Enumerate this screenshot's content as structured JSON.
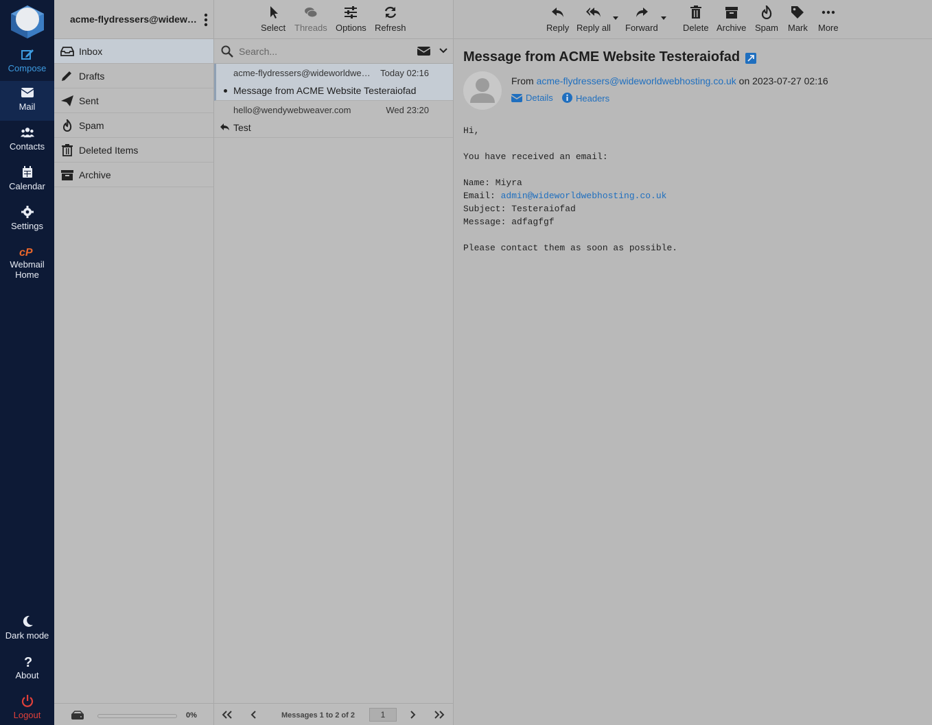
{
  "nav": {
    "items": [
      {
        "id": "compose",
        "label": "Compose"
      },
      {
        "id": "mail",
        "label": "Mail"
      },
      {
        "id": "contacts",
        "label": "Contacts"
      },
      {
        "id": "calendar",
        "label": "Calendar"
      },
      {
        "id": "settings",
        "label": "Settings"
      },
      {
        "id": "webmail-home",
        "label": "Webmail Home"
      },
      {
        "id": "dark-mode",
        "label": "Dark mode"
      },
      {
        "id": "about",
        "label": "About"
      },
      {
        "id": "logout",
        "label": "Logout"
      }
    ],
    "webmail_home_line1": "Webmail",
    "webmail_home_line2": "Home"
  },
  "folders": {
    "account": "acme-flydressers@wideworldwebhosting.co.uk",
    "items": [
      {
        "name": "Inbox",
        "icon": "inbox-icon",
        "selected": true
      },
      {
        "name": "Drafts",
        "icon": "pencil-icon"
      },
      {
        "name": "Sent",
        "icon": "paper-plane-icon"
      },
      {
        "name": "Spam",
        "icon": "fire-icon"
      },
      {
        "name": "Deleted Items",
        "icon": "trash-icon"
      },
      {
        "name": "Archive",
        "icon": "archive-icon"
      }
    ],
    "quota": {
      "percent_label": "0%",
      "fraction": 0
    }
  },
  "list_toolbar": {
    "select": "Select",
    "threads": "Threads",
    "options": "Options",
    "refresh": "Refresh"
  },
  "search": {
    "placeholder": "Search..."
  },
  "messages": [
    {
      "from": "acme-flydressers@wideworldwebhosting.co.uk",
      "date": "Today 02:16",
      "subject": "Message from ACME Website Testeraiofad",
      "selected": true,
      "unread": true
    },
    {
      "from": "hello@wendywebweaver.com",
      "date": "Wed 23:20",
      "subject": "Test",
      "replied": true
    }
  ],
  "list_footer": {
    "count": "Messages 1 to 2 of 2",
    "page": "1"
  },
  "reader_toolbar": {
    "reply": "Reply",
    "reply_all": "Reply all",
    "forward": "Forward",
    "delete": "Delete",
    "archive": "Archive",
    "spam": "Spam",
    "mark": "Mark",
    "more": "More"
  },
  "message": {
    "subject": "Message from ACME Website Testeraiofad",
    "from_prefix": "From",
    "from_address": "acme-flydressers@wideworldwebhosting.co.uk",
    "date_prefix": "on",
    "date": "2023-07-27 02:16",
    "details_label": "Details",
    "headers_label": "Headers",
    "body": {
      "greeting": "Hi,",
      "intro": "You have received an email:",
      "name_line": "Name: Miyra",
      "email_prefix": "Email: ",
      "email": "admin@wideworldwebhosting.co.uk",
      "subject_line": "Subject: Testeraiofad",
      "message_line": "Message: adfagfgf",
      "closing": "Please contact them as soon as possible."
    }
  },
  "colors": {
    "nav_bg": "#0d1a36",
    "accent": "#1f6fbf",
    "logout": "#e0403a",
    "cpanel": "#e8662b",
    "pane_bg": "#bcbcbc"
  }
}
